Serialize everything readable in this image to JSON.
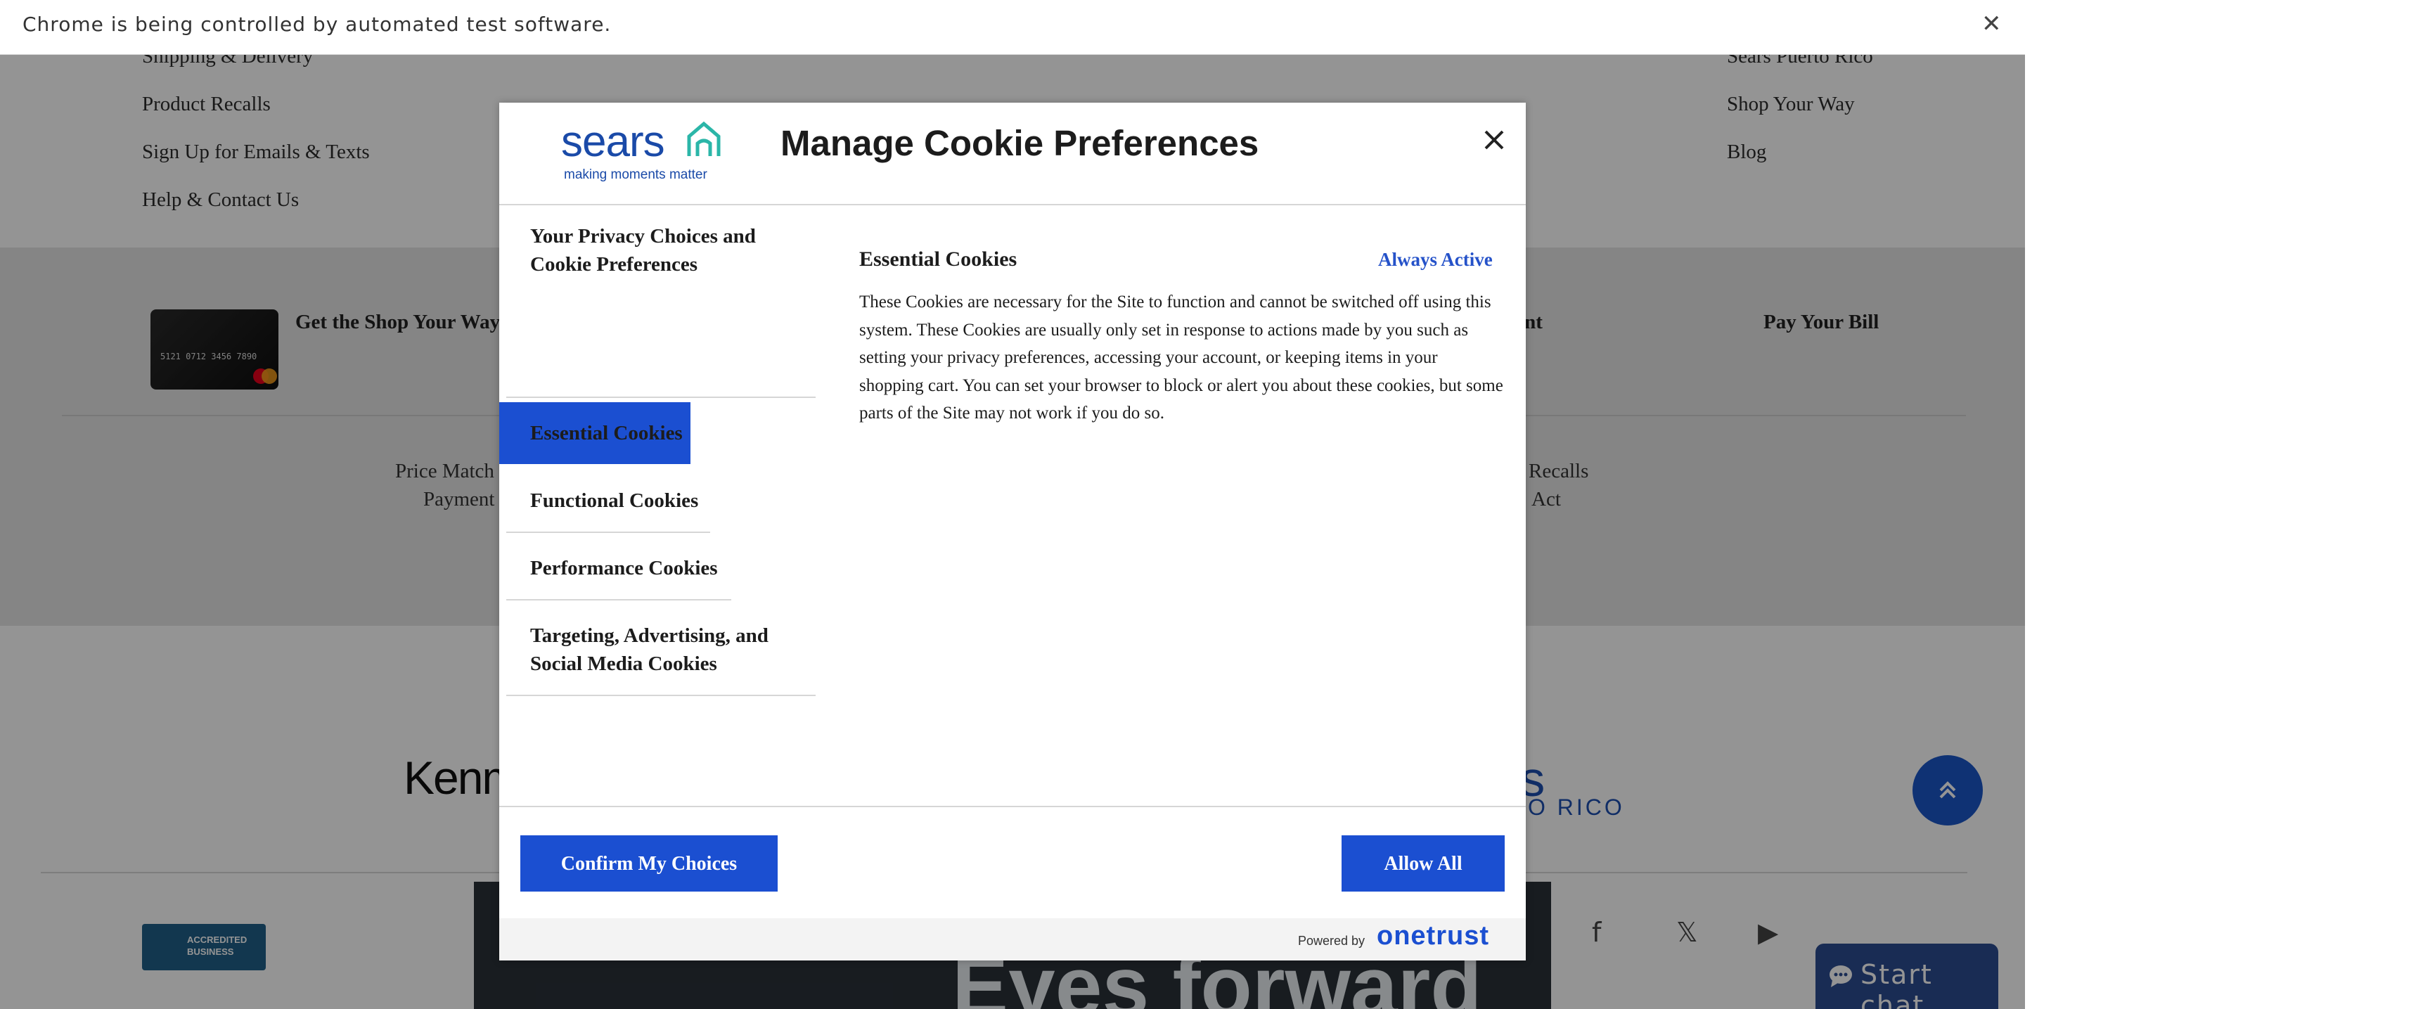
{
  "infobar": {
    "message": "Chrome is being controlled by automated test software.",
    "close_glyph": "✕"
  },
  "page": {
    "top_links_left": [
      "Shipping & Delivery",
      "Product Recalls",
      "Sign Up for Emails & Texts",
      "Help & Contact Us"
    ],
    "top_links_right": [
      "Sears Puerto Rico",
      "Shop Your Way",
      "Blog"
    ],
    "band_card_label": "Get the Shop Your Way",
    "band_account_partial": "unt",
    "band_pay_bill": "Pay Your Bill",
    "band_left_small": [
      "Price Match",
      "Payment"
    ],
    "band_right_small": [
      "Recalls",
      "Act"
    ],
    "card_digits": "5121 0712 3456 7890",
    "brand_kenmore": "Kenm",
    "brand_sears": "ars",
    "brand_rico": "TO RICO",
    "bbb_label": "ACCREDITED BUSINESS",
    "ad_text": "Eyes forward",
    "chat_label": "Start chat"
  },
  "modal": {
    "logo_word": "sears",
    "logo_tagline": "making moments matter",
    "title": "Manage Cookie Preferences",
    "nav": [
      "Your Privacy Choices and Cookie Preferences",
      "Essential Cookies",
      "Functional Cookies",
      "Performance Cookies",
      "Targeting, Advertising, and Social Media Cookies"
    ],
    "active_nav": "Essential Cookies",
    "section_title": "Essential Cookies",
    "status": "Always Active",
    "description": "These Cookies are necessary for the Site to function and cannot be switched off using this system. These Cookies are usually only set in response to actions made by you such as setting your privacy preferences, accessing your account, or keeping items in your shopping cart. You can set your browser to block or alert you about these cookies, but some parts of the Site may not work if you do so.",
    "confirm_button": "Confirm My Choices",
    "allow_button": "Allow All",
    "powered_by": "Powered by",
    "onetrust": "onetrust"
  },
  "colors": {
    "accent": "#1b4fd1",
    "status_link": "#2552c9",
    "brand_blue": "#1a4aa8",
    "chat_bg": "#2c4d91"
  },
  "icons": [
    "close-icon",
    "sears-house-icon",
    "chevron-up-icon",
    "chat-bubble-icon",
    "facebook-icon",
    "x-icon",
    "youtube-icon"
  ]
}
